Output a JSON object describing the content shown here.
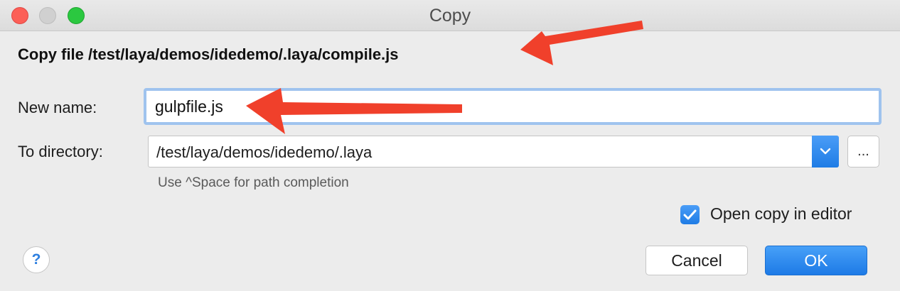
{
  "window": {
    "title": "Copy"
  },
  "dialog": {
    "heading": "Copy file /test/laya/demos/idedemo/.laya/compile.js",
    "new_name_label": "New name:",
    "new_name_value": "gulpfile.js",
    "to_directory_label": "To directory:",
    "to_directory_value": "/test/laya/demos/idedemo/.laya",
    "browse_label": "...",
    "hint": "Use ^Space for path completion",
    "open_in_editor_label": "Open copy in editor",
    "open_in_editor_checked": true,
    "help_label": "?",
    "cancel_label": "Cancel",
    "ok_label": "OK"
  },
  "colors": {
    "accent": "#1f7ce5",
    "annotation_arrow": "#f0402b"
  }
}
